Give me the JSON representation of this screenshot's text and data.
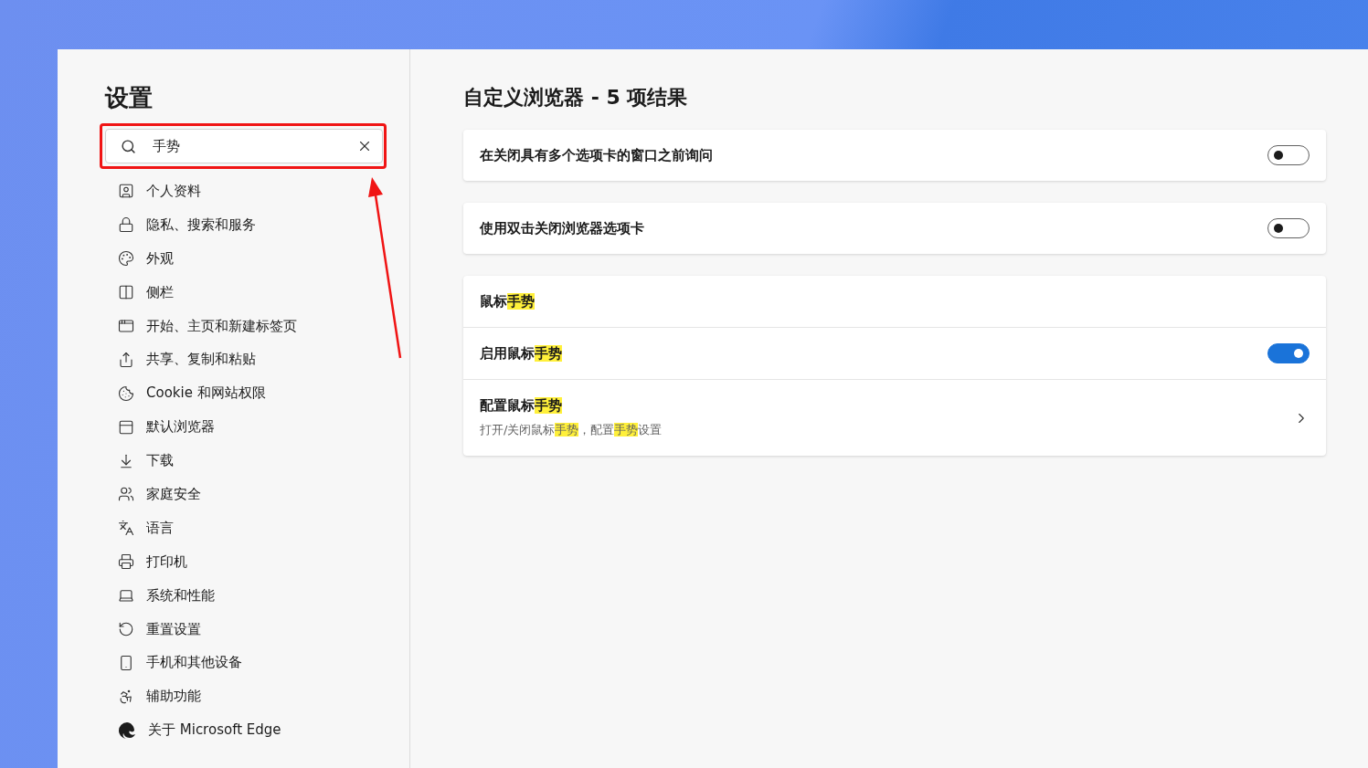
{
  "sidebar": {
    "title": "设置",
    "search": {
      "value": "手势",
      "annotated": true
    },
    "items": [
      {
        "label": "个人资料"
      },
      {
        "label": "隐私、搜索和服务"
      },
      {
        "label": "外观"
      },
      {
        "label": "侧栏"
      },
      {
        "label": "开始、主页和新建标签页"
      },
      {
        "label": "共享、复制和粘贴"
      },
      {
        "label": "Cookie 和网站权限"
      },
      {
        "label": "默认浏览器"
      },
      {
        "label": "下载"
      },
      {
        "label": "家庭安全"
      },
      {
        "label": "语言"
      },
      {
        "label": "打印机"
      },
      {
        "label": "系统和性能"
      },
      {
        "label": "重置设置"
      },
      {
        "label": "手机和其他设备"
      },
      {
        "label": "辅助功能"
      },
      {
        "label": "关于 Microsoft Edge"
      }
    ]
  },
  "main": {
    "title": "自定义浏览器 - 5 项结果",
    "cards": [
      {
        "rows": [
          {
            "kind": "toggle",
            "label": [
              {
                "text": "在关闭具有多个选项卡的窗口之前询问",
                "highlighted": false
              }
            ],
            "on": false
          }
        ]
      },
      {
        "rows": [
          {
            "kind": "toggle",
            "label": [
              {
                "text": "使用双击关闭浏览器选项卡",
                "highlighted": false
              }
            ],
            "on": false
          }
        ]
      },
      {
        "rows": [
          {
            "kind": "heading",
            "label": [
              {
                "text": "鼠标",
                "highlighted": false
              },
              {
                "text": "手势",
                "highlighted": true
              }
            ]
          },
          {
            "kind": "toggle",
            "label": [
              {
                "text": "启用鼠标",
                "highlighted": false
              },
              {
                "text": "手势",
                "highlighted": true
              }
            ],
            "on": true
          },
          {
            "kind": "link",
            "label": [
              {
                "text": "配置鼠标",
                "highlighted": false
              },
              {
                "text": "手势",
                "highlighted": true
              }
            ],
            "description": [
              {
                "text": "打开/关闭鼠标",
                "highlighted": false
              },
              {
                "text": "手势",
                "highlighted": true
              },
              {
                "text": "，配置",
                "highlighted": false
              },
              {
                "text": "手势",
                "highlighted": true
              },
              {
                "text": "设置",
                "highlighted": false
              }
            ]
          }
        ]
      }
    ]
  }
}
